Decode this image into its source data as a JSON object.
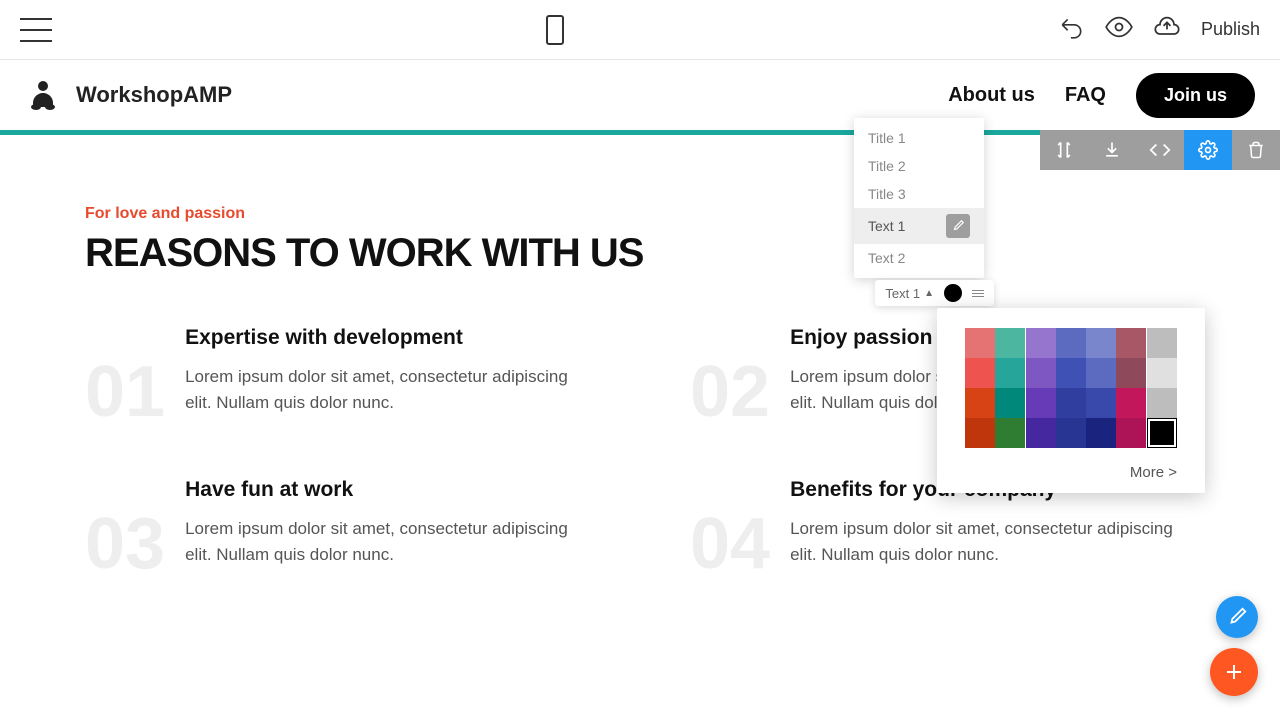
{
  "toolbar": {
    "publish_label": "Publish"
  },
  "brand": {
    "name": "WorkshopAMP"
  },
  "nav": {
    "about": "About us",
    "faq": "FAQ",
    "join": "Join us"
  },
  "section": {
    "subtitle": "For love and passion",
    "title": "REASONS TO WORK WITH US"
  },
  "features": [
    {
      "num": "01",
      "title": "Expertise with development",
      "text": "Lorem ipsum dolor sit amet, consectetur adipiscing elit. Nullam quis dolor nunc."
    },
    {
      "num": "02",
      "title": "Enjoy passion & money",
      "text": "Lorem ipsum dolor sit amet, consectetur adipiscing elit. Nullam quis dolor nunc."
    },
    {
      "num": "03",
      "title": "Have fun at work",
      "text": "Lorem ipsum dolor sit amet, consectetur adipiscing elit. Nullam quis dolor nunc."
    },
    {
      "num": "04",
      "title": "Benefits for your company",
      "text": "Lorem ipsum dolor sit amet, consectetur adipiscing elit. Nullam quis dolor nunc."
    }
  ],
  "style_dropdown": {
    "items": [
      "Title 1",
      "Title 2",
      "Title 3",
      "Text 1",
      "Text 2"
    ],
    "selected": "Text 1"
  },
  "mini_toolbar": {
    "label": "Text 1"
  },
  "color_picker": {
    "rows": [
      [
        "#e57373",
        "#4db6a0",
        "#9575cd",
        "#5c6bc0",
        "#7986cb",
        "#a85766",
        "#bdbdbd"
      ],
      [
        "#ef5350",
        "#26a69a",
        "#7e57c2",
        "#3f51b5",
        "#5c6bc0",
        "#8e4a5a",
        "#9e9e9e"
      ],
      [
        "#d84315",
        "#00897b",
        "#673ab7",
        "#303f9f",
        "#3949ab",
        "#c2185b",
        "#424242"
      ],
      [
        "#bf360c",
        "#2e7d32",
        "#4527a0",
        "#283593",
        "#1a237e",
        "#ad1457",
        "#000000"
      ]
    ],
    "extras": [
      "#e0e0e0",
      "#bdbdbd"
    ],
    "selected": "#000000",
    "more_label": "More >"
  }
}
